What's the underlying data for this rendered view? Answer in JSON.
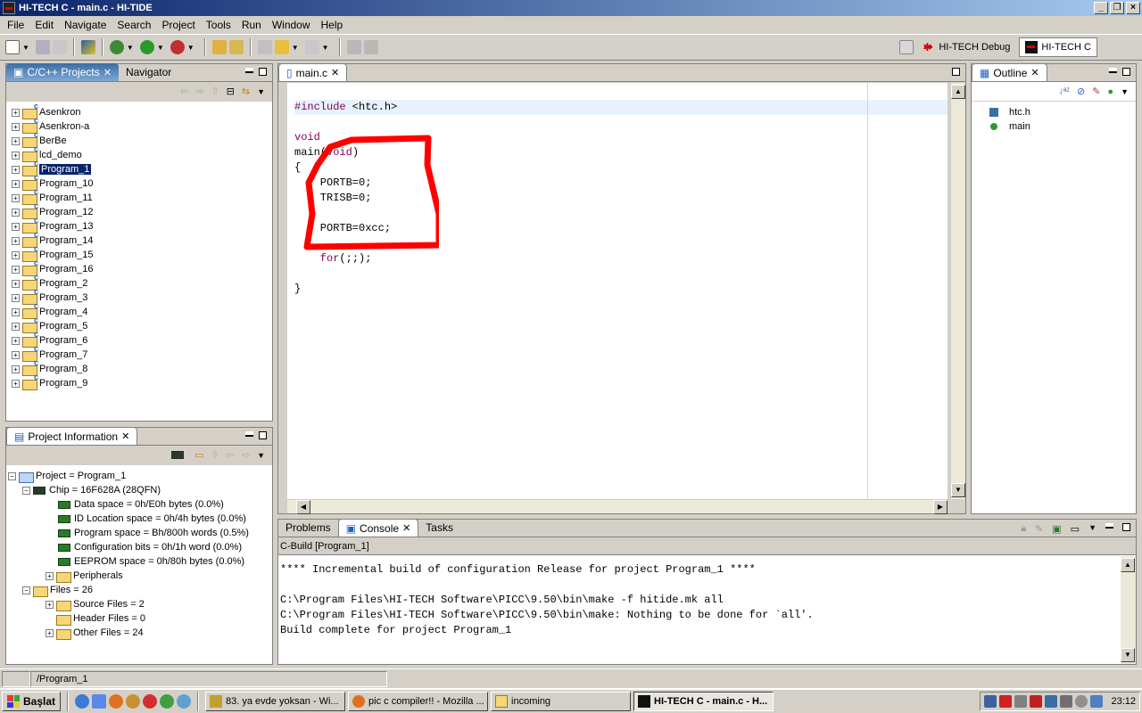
{
  "window": {
    "title": "HI-TECH C - main.c - HI-TIDE"
  },
  "menu": [
    "File",
    "Edit",
    "Navigate",
    "Search",
    "Project",
    "Tools",
    "Run",
    "Window",
    "Help"
  ],
  "perspectives": {
    "debug": "HI-TECH Debug",
    "c": "HI-TECH C"
  },
  "projects_panel": {
    "tabs": {
      "projects": "C/C++ Projects",
      "navigator": "Navigator"
    },
    "items": [
      "Asenkron",
      "Asenkron-a",
      "BerBe",
      "lcd_demo",
      "Program_1",
      "Program_10",
      "Program_11",
      "Program_12",
      "Program_13",
      "Program_14",
      "Program_15",
      "Program_16",
      "Program_2",
      "Program_3",
      "Program_4",
      "Program_5",
      "Program_6",
      "Program_7",
      "Program_8",
      "Program_9"
    ],
    "selected_index": 4
  },
  "project_info": {
    "tab": "Project Information",
    "project": "Project = Program_1",
    "chip": "Chip = 16F628A (28QFN)",
    "data_space": "Data space = 0h/E0h bytes (0.0%)",
    "id_location": "ID Location space = 0h/4h bytes (0.0%)",
    "program_space": "Program space = Bh/800h words (0.5%)",
    "config_bits": "Configuration bits = 0h/1h word (0.0%)",
    "eeprom": "EEPROM space = 0h/80h bytes (0.0%)",
    "peripherals": "Peripherals",
    "files": "Files = 26",
    "source_files": "Source Files = 2",
    "header_files": "Header Files = 0",
    "other_files": "Other Files = 24"
  },
  "editor": {
    "tab": "main.c",
    "lines": {
      "l1_kw": "#include",
      "l1_rest": " <htc.h>",
      "l3": "void",
      "l4_a": "main(",
      "l4_b": "void",
      "l4_c": ")",
      "l5": "{",
      "l6": "    PORTB=0;",
      "l7": "    TRISB=0;",
      "l9": "    PORTB=0xcc;",
      "l11_kw": "    for",
      "l11_rest": "(;;);",
      "l13": "}"
    }
  },
  "outline": {
    "tab": "Outline",
    "items": [
      "htc.h",
      "main"
    ]
  },
  "bottom_panel": {
    "tabs": {
      "problems": "Problems",
      "console": "Console",
      "tasks": "Tasks"
    },
    "console_title": "C-Build [Program_1]",
    "lines": [
      "**** Incremental build of configuration Release for project Program_1 ****",
      "",
      "C:\\Program Files\\HI-TECH Software\\PICC\\9.50\\bin\\make -f hitide.mk all",
      "C:\\Program Files\\HI-TECH Software\\PICC\\9.50\\bin\\make: Nothing to be done for `all'.",
      "Build complete for project Program_1"
    ]
  },
  "status": {
    "path": "/Program_1"
  },
  "taskbar": {
    "start": "Başlat",
    "tasks": [
      "83. ya evde yoksan - Wi...",
      "pic c compiler!! - Mozilla ...",
      "incoming",
      "HI-TECH C - main.c - H..."
    ],
    "active_index": 3,
    "clock": "23:12"
  }
}
